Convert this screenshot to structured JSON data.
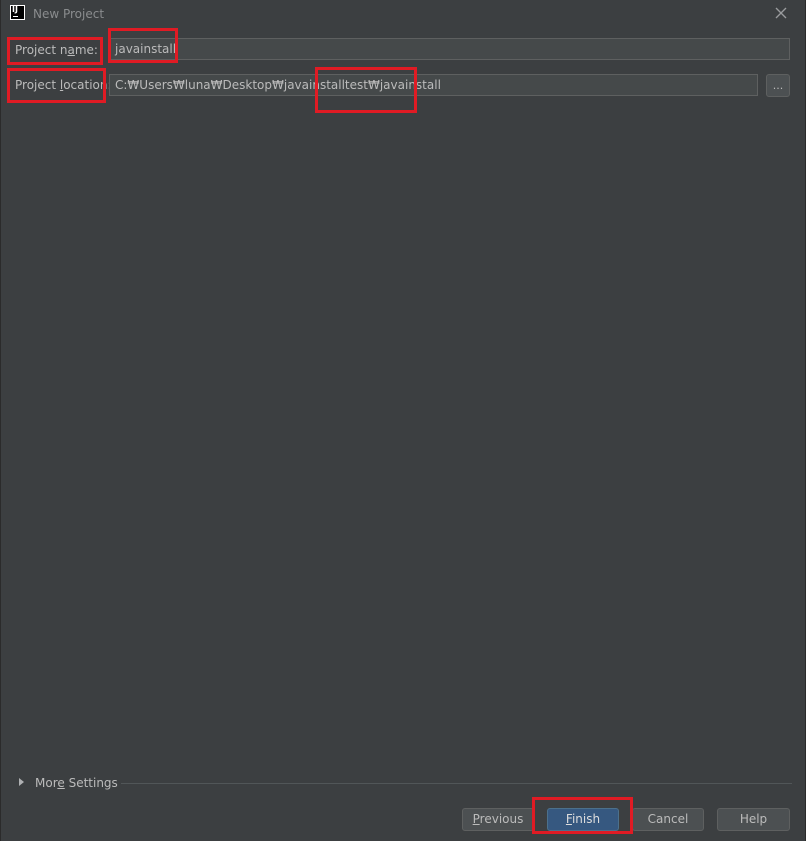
{
  "window": {
    "title": "New Project",
    "app_icon": "intellij-idea-icon",
    "close_icon": "close-icon"
  },
  "form": {
    "project_name": {
      "label_pre": "Project n",
      "label_mnemonic": "a",
      "label_post": "me:",
      "value": "javainstall"
    },
    "project_location": {
      "label_pre": "Project ",
      "label_mnemonic": "l",
      "label_post": "ocation:",
      "value": "C:₩Users₩luna₩Desktop₩javainstalltest₩javainstall",
      "browse_label": "..."
    }
  },
  "more_settings": {
    "label_pre": "Mor",
    "label_mnemonic": "e",
    "label_post": " Settings",
    "expand_icon": "triangle-right-icon"
  },
  "buttons": {
    "previous": {
      "mnemonic": "P",
      "rest": "revious"
    },
    "finish": {
      "mnemonic": "F",
      "rest": "inish"
    },
    "cancel": "Cancel",
    "help": "Help"
  },
  "colors": {
    "background": "#3c3f41",
    "input_background": "#45494a",
    "primary_button": "#365880",
    "highlight_box": "#e01b24",
    "text": "#bbbbbb"
  }
}
